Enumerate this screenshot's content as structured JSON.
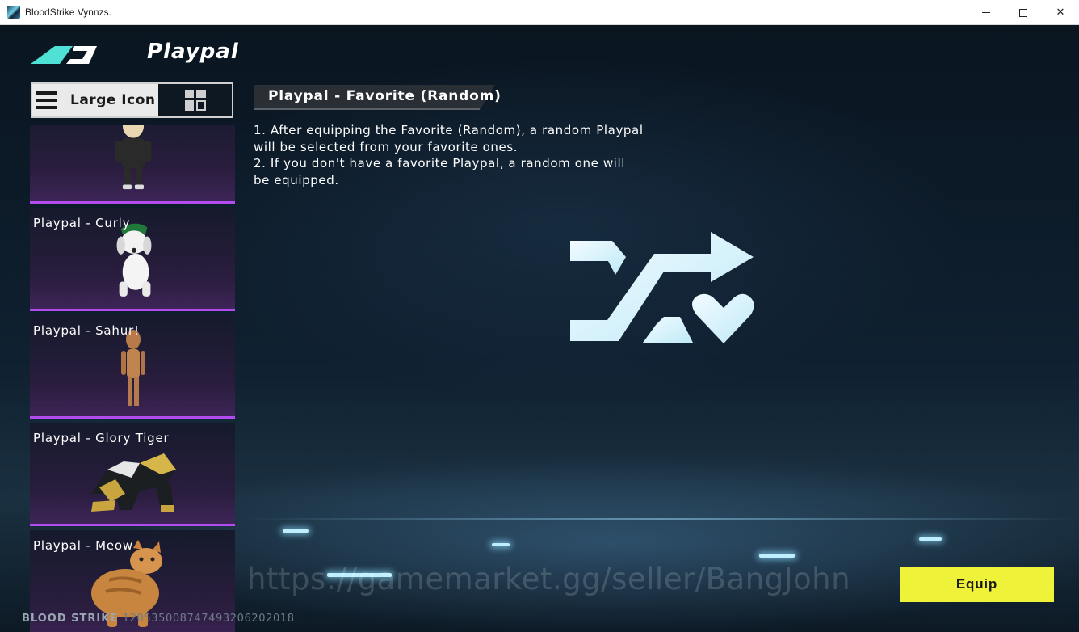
{
  "window": {
    "title": "BloodStrike Vynnzs.",
    "minimize_glyph": "",
    "close_glyph": "✕"
  },
  "header": {
    "title": "Playpal"
  },
  "view_toggle": {
    "list_label": "Large Icon",
    "list_icon": "hamburger-icon",
    "grid_icon": "grid-icon"
  },
  "playpals": [
    {
      "label": "",
      "art": "playpal-bald-boy-figure"
    },
    {
      "label": "Playpal - Curly",
      "art": "playpal-white-dog-green-cap"
    },
    {
      "label": "Playpal - Sahur!",
      "art": "playpal-wooden-figure"
    },
    {
      "label": "Playpal - Glory Tiger",
      "art": "playpal-armored-gold-tiger"
    },
    {
      "label": "Playpal - Meow",
      "art": "playpal-orange-cat"
    }
  ],
  "detail": {
    "title": "Playpal - Favorite (Random)",
    "lines": [
      "1. After equipping the Favorite (Random), a random Playpal",
      "will be selected from your favorite ones.",
      "2. If you don't have a favorite Playpal, a random one will",
      "be equipped."
    ],
    "icon": "shuffle-heart-icon"
  },
  "footer": {
    "brand": "BLOOD STRIKE",
    "uid": "1205350087474932062020​18",
    "watermark": "https://gamemarket.gg/seller/BangJohn"
  },
  "actions": {
    "equip_label": "Equip"
  },
  "colors": {
    "accent_purple": "#b24bf0",
    "equip_yellow": "#eef239",
    "icon_cyan": "#d9f5ff"
  }
}
